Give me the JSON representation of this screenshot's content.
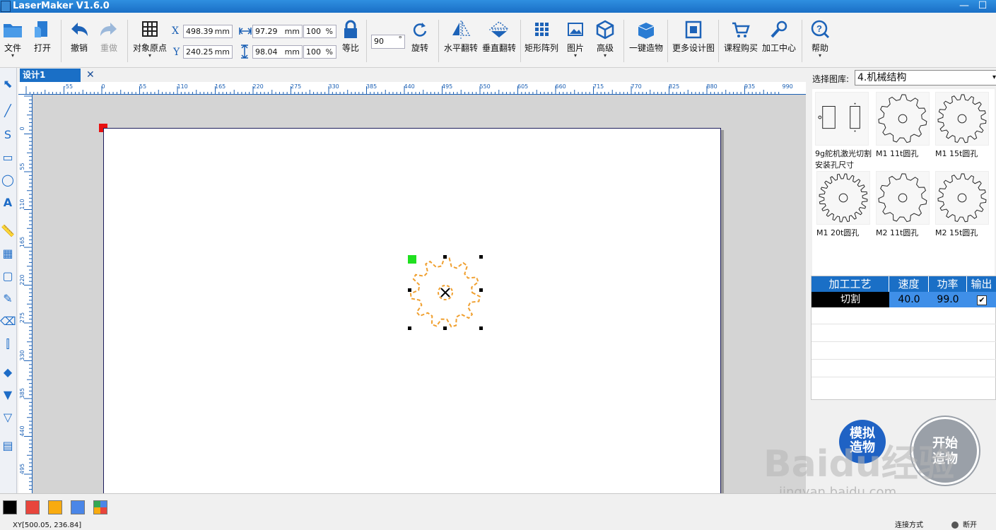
{
  "app": {
    "title": "LaserMaker V1.6.0"
  },
  "toolbar": {
    "file": "文件",
    "open": "打开",
    "undo": "撤销",
    "redo": "重做",
    "origin": "对象原点",
    "x_label": "X",
    "y_label": "Y",
    "x_value": "498.39",
    "y_value": "240.25",
    "w_value": "97.29",
    "h_value": "98.04",
    "w_pct": "100",
    "h_pct": "100",
    "unit_mm": "mm",
    "unit_pct": "%",
    "lock_ratio": "等比",
    "rotate_value": "90",
    "degree": "°",
    "rotate": "旋转",
    "flip_h": "水平翻转",
    "flip_v": "垂直翻转",
    "rect_array": "矩形阵列",
    "image": "图片",
    "advanced": "高级",
    "one_click": "一键造物",
    "more_designs": "更多设计图",
    "course_buy": "课程购买",
    "process_center": "加工中心",
    "help": "帮助"
  },
  "tabs": [
    {
      "label": "设计1",
      "close": "✕"
    }
  ],
  "ruler": {
    "top_ticks": [
      "-55",
      "0",
      "55",
      "110",
      "165",
      "220",
      "275",
      "330",
      "385",
      "440",
      "495",
      "550",
      "605",
      "660",
      "715",
      "770",
      "825",
      "880",
      "935",
      "990"
    ],
    "left_ticks": [
      "0",
      "55",
      "110",
      "165",
      "220",
      "275",
      "330",
      "385",
      "440",
      "495"
    ]
  },
  "library": {
    "select_label": "选择图库:",
    "selected": "4.机械结构",
    "items": [
      {
        "name": "9g舵机激光切割安装孔尺寸",
        "icon": "servo-outline-icon"
      },
      {
        "name": "M1 11t圆孔",
        "icon": "gear-icon"
      },
      {
        "name": "M1 15t圆孔",
        "icon": "gear-icon"
      },
      {
        "name": "M1 20t圆孔",
        "icon": "gear-icon"
      },
      {
        "name": "M2 11t圆孔",
        "icon": "gear-icon"
      },
      {
        "name": "M2 15t圆孔",
        "icon": "gear-icon"
      }
    ]
  },
  "process_table": {
    "headers": [
      "加工工艺",
      "速度",
      "功率",
      "输出"
    ],
    "rows": [
      {
        "process": "切割",
        "speed": "40.0",
        "power": "99.0",
        "output": "✔"
      }
    ]
  },
  "actions": {
    "simulate": "模拟造物",
    "start": "开始造物"
  },
  "colors": {
    "accent": "#1a6fc6",
    "swatches": [
      "#000000",
      "#e8453c",
      "#f9ab0f",
      "#4a86e8"
    ],
    "gear_stroke": "#f0a030",
    "origin_marker": "#e81010",
    "rotate_handle": "#20e020"
  },
  "watermark": {
    "text": "Baidu经验",
    "url": "jingyan.baidu.com"
  },
  "status": {
    "cursor": "XY[500.05, 236.84]",
    "connect_mode": "连接方式",
    "disconnected": "断开"
  }
}
